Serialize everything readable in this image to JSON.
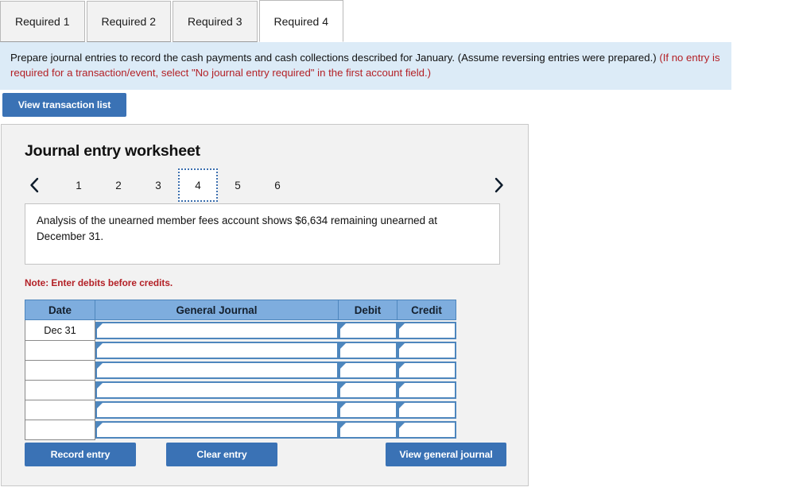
{
  "tabs": [
    {
      "label": "Required 1",
      "active": false
    },
    {
      "label": "Required 2",
      "active": false
    },
    {
      "label": "Required 3",
      "active": false
    },
    {
      "label": "Required 4",
      "active": true
    }
  ],
  "banner": {
    "main_text": "Prepare journal entries to record the cash payments and cash collections described for January. (Assume reversing entries were prepared.) ",
    "red_text": "(If no entry is required for a transaction/event, select \"No journal entry required\" in the first account field.)"
  },
  "toolbar": {
    "view_transaction_list_label": "View transaction list"
  },
  "worksheet": {
    "title": "Journal entry worksheet",
    "pager": {
      "prev_icon": "chevron-left-icon",
      "next_icon": "chevron-right-icon",
      "pages": [
        {
          "label": "1",
          "current": false
        },
        {
          "label": "2",
          "current": false
        },
        {
          "label": "3",
          "current": false
        },
        {
          "label": "4",
          "current": true
        },
        {
          "label": "5",
          "current": false
        },
        {
          "label": "6",
          "current": false
        }
      ]
    },
    "description": "Analysis of the unearned member fees account shows $6,634 remaining unearned at December 31.",
    "note": "Note: Enter debits before credits.",
    "table": {
      "headers": [
        "Date",
        "General Journal",
        "Debit",
        "Credit"
      ],
      "rows": [
        {
          "date": "Dec 31",
          "general_journal": "",
          "debit": "",
          "credit": ""
        },
        {
          "date": "",
          "general_journal": "",
          "debit": "",
          "credit": ""
        },
        {
          "date": "",
          "general_journal": "",
          "debit": "",
          "credit": ""
        },
        {
          "date": "",
          "general_journal": "",
          "debit": "",
          "credit": ""
        },
        {
          "date": "",
          "general_journal": "",
          "debit": "",
          "credit": ""
        },
        {
          "date": "",
          "general_journal": "",
          "debit": "",
          "credit": ""
        }
      ]
    },
    "buttons": {
      "record_entry": "Record entry",
      "clear_entry": "Clear entry",
      "view_general_journal": "View general journal"
    }
  },
  "colors": {
    "accent_blue": "#3a72b5",
    "table_header_blue": "#7eadde",
    "field_border_blue": "#4e86bd",
    "banner_bg": "#dcebf7",
    "note_red": "#b32026",
    "panel_bg": "#f2f2f2"
  }
}
